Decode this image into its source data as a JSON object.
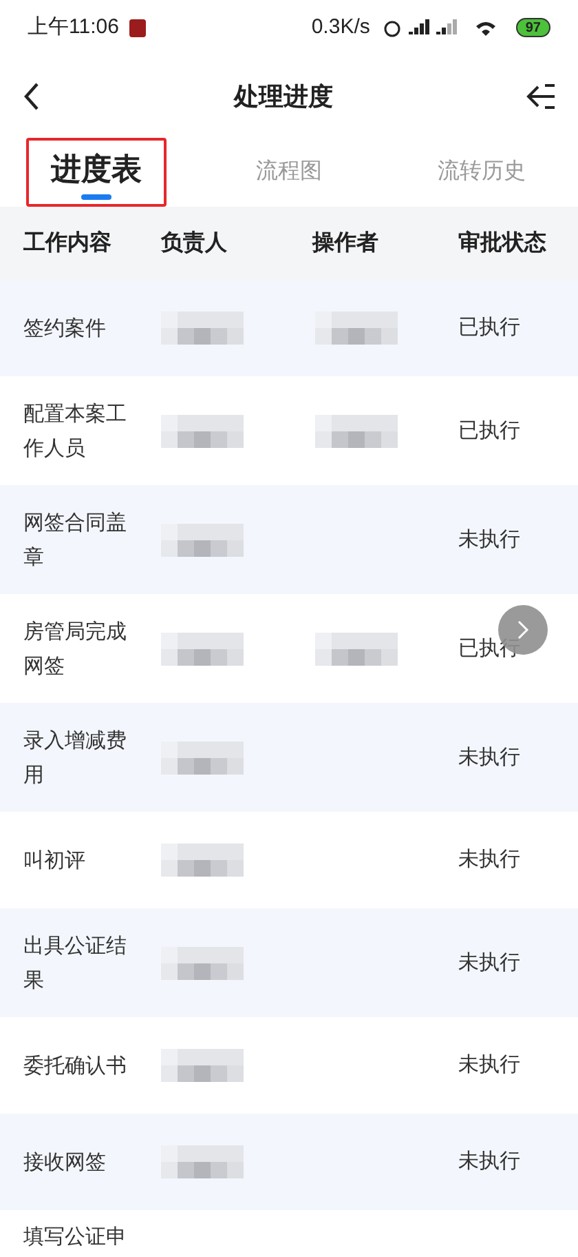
{
  "status_bar": {
    "time": "上午11:06",
    "speed": "0.3K/s",
    "battery": "97"
  },
  "nav": {
    "title": "处理进度"
  },
  "tabs": [
    {
      "label": "进度表",
      "selected": true,
      "highlighted": true
    },
    {
      "label": "流程图",
      "selected": false,
      "highlighted": false
    },
    {
      "label": "流转历史",
      "selected": false,
      "highlighted": false
    }
  ],
  "table": {
    "columns": [
      "工作内容",
      "负责人",
      "操作者",
      "审批状态"
    ],
    "rows": [
      {
        "task": "签约案件",
        "owner_redacted": true,
        "operator_redacted": true,
        "status": "已执行"
      },
      {
        "task": "配置本案工作人员",
        "owner_redacted": true,
        "operator_redacted": true,
        "status": "已执行"
      },
      {
        "task": "网签合同盖章",
        "owner_redacted": true,
        "operator_redacted": false,
        "status": "未执行"
      },
      {
        "task": "房管局完成网签",
        "owner_redacted": true,
        "operator_redacted": true,
        "status": "已执行"
      },
      {
        "task": "录入增减费用",
        "owner_redacted": true,
        "operator_redacted": false,
        "status": "未执行"
      },
      {
        "task": "叫初评",
        "owner_redacted": true,
        "operator_redacted": false,
        "status": "未执行"
      },
      {
        "task": "出具公证结果",
        "owner_redacted": true,
        "operator_redacted": false,
        "status": "未执行"
      },
      {
        "task": "委托确认书",
        "owner_redacted": true,
        "operator_redacted": false,
        "status": "未执行"
      },
      {
        "task": "接收网签",
        "owner_redacted": true,
        "operator_redacted": false,
        "status": "未执行"
      },
      {
        "task": "填写公证申",
        "owner_redacted": false,
        "operator_redacted": false,
        "status": ""
      }
    ]
  }
}
